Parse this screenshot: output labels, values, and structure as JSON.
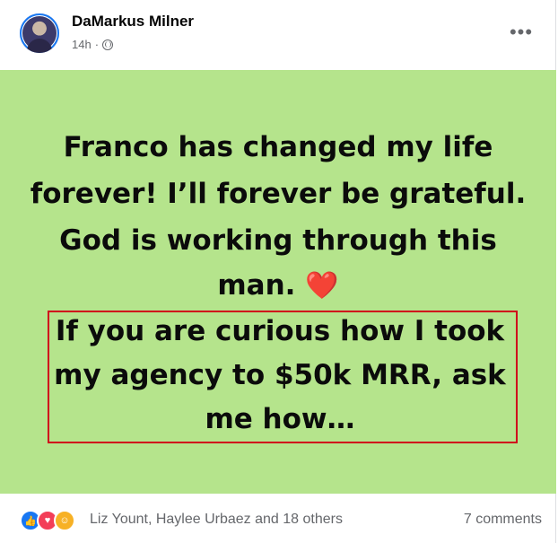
{
  "post": {
    "author": "DaMarkus Milner",
    "time": "14h",
    "separator": "·",
    "audience_icon": "globe-icon",
    "more_label": "•••",
    "background_color": "#b5e48c",
    "text_lines": [
      "Franco has changed my life",
      "forever! I’ll forever be grateful.",
      "God is working through this",
      "man."
    ],
    "heart_emoji": "❤️",
    "boxed_lines": [
      "If you are curious how I took",
      "my agency to $50k MRR, ask",
      "me how…"
    ],
    "box_border_color": "#d0021b"
  },
  "footer": {
    "reaction_icons": [
      "like-icon",
      "love-icon",
      "care-icon"
    ],
    "reactors": "Liz Yount, Haylee Urbaez and 18 others",
    "comments": "7 comments"
  }
}
